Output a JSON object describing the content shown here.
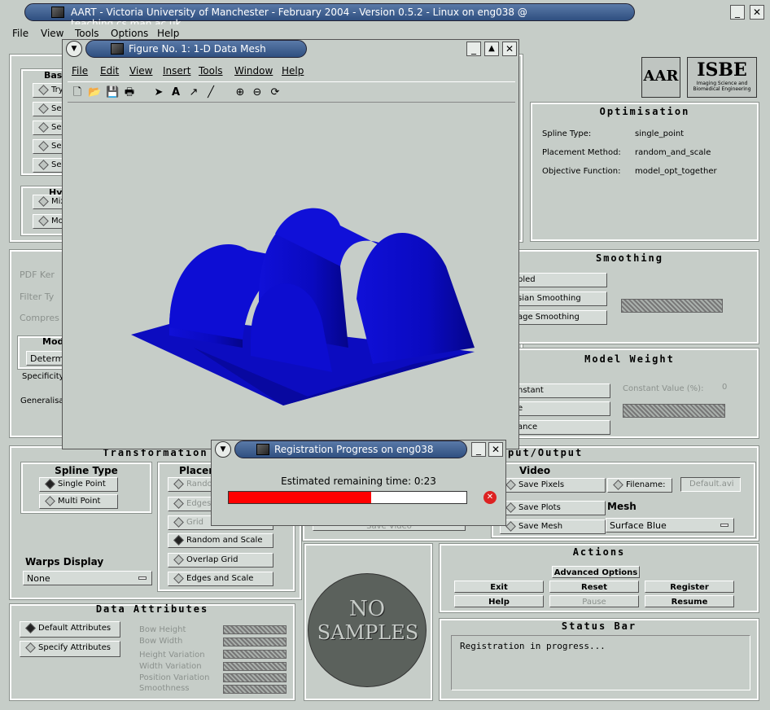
{
  "window": {
    "title": "AART - Victoria University of Manchester - February 2004 - Version 0.5.2 - Linux on eng038 @ teaching.cs.man.ac.uk",
    "menu_icon": "chevron-down-icon",
    "minimize": "_",
    "close": "✕"
  },
  "menu": [
    "File",
    "View",
    "Tools",
    "Options",
    "Help"
  ],
  "basis": {
    "title": "Bas",
    "items": [
      "Try",
      "Seq",
      "Seq",
      "Seq",
      "Seq"
    ]
  },
  "hybrid": {
    "title": "Hy",
    "items": [
      "Mix",
      "Mod"
    ]
  },
  "pdf": {
    "labels": [
      "PDF Ker",
      "Filter Ty",
      "Compres"
    ],
    "mode_title": "Mod",
    "mode_value": "Determ",
    "specificity": "Specificity",
    "generalisation": "Generalisat"
  },
  "logos": {
    "aart": "AAR",
    "isbe": "ISBE",
    "isbe_sub": "Imaging Science and Biomedical Engineering"
  },
  "optimisation": {
    "title": "Optimisation",
    "rows": [
      {
        "k": "Spline Type:",
        "v": "single_point"
      },
      {
        "k": "Placement Method:",
        "v": "random_and_scale"
      },
      {
        "k": "Objective Function:",
        "v": "model_opt_together"
      }
    ]
  },
  "smoothing": {
    "title": "Smoothing",
    "buttons": [
      "bled",
      "sian Smoothing",
      "age Smoothing"
    ]
  },
  "model_weight": {
    "title": "Model Weight",
    "buttons": [
      "nstant",
      "e",
      "ance"
    ],
    "constant_label": "Constant Value (%):",
    "constant_value": "0"
  },
  "transformation": {
    "title": "Transformation",
    "spline_title": "Spline Type",
    "spline": [
      "Single Point",
      "Multi Point"
    ],
    "place_title": "Placen",
    "place": [
      "Random",
      "Edges",
      "Grid",
      "Random and Scale",
      "Overlap Grid",
      "Edges and Scale"
    ],
    "warps_title": "Warps Display",
    "warps_value": "None",
    "save_video": "Save Video"
  },
  "io": {
    "title": "put/Output",
    "video": "Video",
    "save": [
      "Save Pixels",
      "Save Plots",
      "Save Mesh"
    ],
    "filename_label": "Filename:",
    "filename_value": "Default.avi",
    "mesh_title": "Mesh",
    "mesh_value": "Surface Blue"
  },
  "data_attributes": {
    "title": "Data Attributes",
    "buttons": [
      "Default Attributes",
      "Specify Attributes"
    ],
    "labels": [
      "Bow Height",
      "Bow Width",
      "Height Variation",
      "Width Variation",
      "Position Variation",
      "Smoothness"
    ]
  },
  "no_samples": {
    "line1": "NO",
    "line2": "SAMPLES"
  },
  "actions": {
    "title": "Actions",
    "advanced": "Advanced Options",
    "row1": [
      "Exit",
      "Reset",
      "Register"
    ],
    "row2": [
      "Help",
      "Pause",
      "Resume"
    ]
  },
  "status": {
    "title": "Status Bar",
    "text": "Registration in progress..."
  },
  "figure": {
    "title": "Figure No. 1: 1-D Data Mesh",
    "menu": [
      "File",
      "Edit",
      "View",
      "Insert",
      "Tools",
      "Window",
      "Help"
    ],
    "minimize": "_",
    "maximize": "▲",
    "close": "✕"
  },
  "progress": {
    "title": "Registration Progress on eng038",
    "label": "Estimated remaining time: 0:23",
    "fraction": 0.6,
    "bar_color": "#ff0000",
    "minimize": "_",
    "close": "✕",
    "cancel": "✕"
  }
}
